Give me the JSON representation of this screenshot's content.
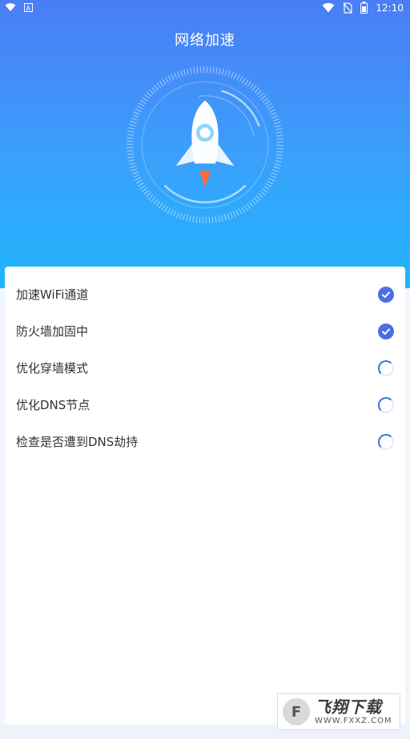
{
  "status_bar": {
    "time": "12:10",
    "left_icons": [
      "wifi-icon",
      "app-a-icon"
    ],
    "right_icons": [
      "wifi-signal-icon",
      "no-sim-icon",
      "battery-icon"
    ]
  },
  "header": {
    "title": "网络加速"
  },
  "steps": [
    {
      "label": "加速WiFi通道",
      "state": "done"
    },
    {
      "label": "防火墙加固中",
      "state": "done"
    },
    {
      "label": "优化穿墙模式",
      "state": "loading"
    },
    {
      "label": "优化DNS节点",
      "state": "loading"
    },
    {
      "label": "检查是否遭到DNS劫持",
      "state": "loading"
    }
  ],
  "colors": {
    "gradient_top": "#4b7df6",
    "gradient_bottom": "#20b5fd",
    "check": "#4b6fe3",
    "spinner": "#3f73e2"
  },
  "watermark": {
    "main": "飞翔下载",
    "sub": "WWW.FXXZ.COM"
  }
}
